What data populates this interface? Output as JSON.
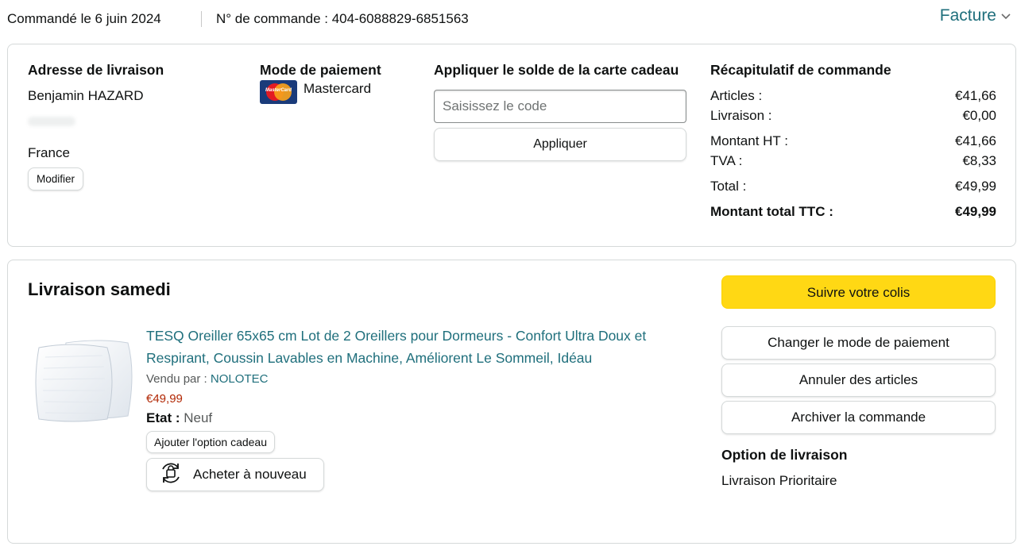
{
  "header": {
    "order_date": "Commandé le 6 juin 2024",
    "order_number": "N° de commande : 404-6088829-6851563",
    "invoice_label": "Facture",
    "invoice_chevron": "chevron-down-icon"
  },
  "shipping_address": {
    "title": "Adresse de livraison",
    "name": "Benjamin HAZARD",
    "country": "France",
    "edit_label": "Modifier"
  },
  "payment": {
    "title": "Mode de paiement",
    "card_logo_text": "MasterCard",
    "card_label": "Mastercard"
  },
  "gift_card": {
    "title": "Appliquer le solde de la carte cadeau",
    "placeholder": "Saisissez le code",
    "apply_label": "Appliquer"
  },
  "order_summary": {
    "title": "Récapitulatif de commande",
    "rows": [
      {
        "label": "Articles :",
        "value": "€41,66"
      },
      {
        "label": "Livraison :",
        "value": "€0,00"
      },
      {
        "label": "Montant HT :",
        "value": "€41,66"
      },
      {
        "label": "TVA :",
        "value": "€8,33"
      },
      {
        "label": "Total :",
        "value": "€49,99"
      },
      {
        "label": "Montant total TTC :",
        "value": "€49,99"
      }
    ]
  },
  "shipment": {
    "title": "Livraison samedi",
    "product": {
      "title": "TESQ Oreiller 65x65 cm Lot de 2 Oreillers pour Dormeurs - Confort Ultra Doux et Respirant, Coussin Lavables en Machine, Améliorent Le Sommeil, Idéau",
      "sold_by_label": "Vendu par :",
      "seller": "NOLOTEC",
      "price": "€49,99",
      "condition_label": "Etat :",
      "condition": "Neuf",
      "gift_option_label": "Ajouter l'option cadeau",
      "buy_again_label": "Acheter à nouveau",
      "buy_again_icon": "reorder-icon"
    },
    "actions": {
      "track": "Suivre votre colis",
      "change_payment": "Changer le mode de paiement",
      "cancel_items": "Annuler des articles",
      "archive": "Archiver la commande"
    },
    "delivery_option_title": "Option de livraison",
    "delivery_option_value": "Livraison Prioritaire"
  },
  "colors": {
    "link": "#1f6f7c",
    "price": "#b12704",
    "primary_button": "#ffd814",
    "border": "#d5d9d9"
  }
}
